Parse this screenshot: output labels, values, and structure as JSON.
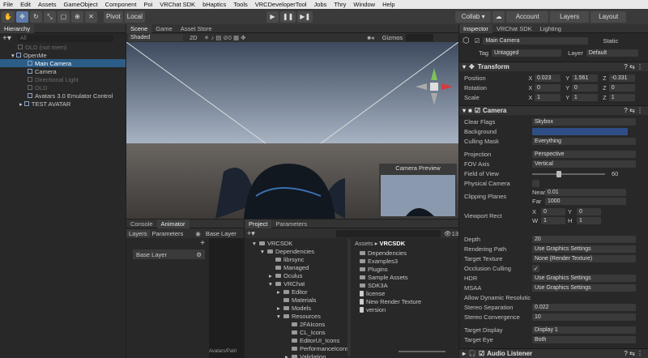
{
  "menu": [
    "File",
    "Edit",
    "Assets",
    "GameObject",
    "Component",
    "Poi",
    "VRChat SDK",
    "bHaptics",
    "Tools",
    "VRCDeveloperTool",
    "Jobs",
    "Thry",
    "Window",
    "Help"
  ],
  "toolbar": {
    "pivot": "Pivot",
    "local": "Local",
    "collab": "Collab ▾",
    "account": "Account",
    "layers": "Layers",
    "layout": "Layout"
  },
  "hierarchy": {
    "tab": "Hierarchy",
    "search": "All",
    "items": [
      "OLD (not mem)",
      "OpenMe",
      "Main Camera",
      "Camera",
      "Directional Light",
      "OLD",
      "Avatars 3.0 Emulator Control",
      "TEST AVATAR"
    ]
  },
  "scene": {
    "tabs": [
      "Scene",
      "Game",
      "Asset Store"
    ],
    "shading": "Shaded",
    "mode2d": "2D",
    "gizmos": "Gizmos",
    "preview_title": "Camera Preview"
  },
  "console": {
    "tabs": [
      "Console",
      "Animator"
    ],
    "sub": [
      "Layers",
      "Parameters"
    ],
    "base": "Base Layer",
    "base_layer": "Base Layer",
    "avatar_path": "Avatars/Patri"
  },
  "project": {
    "tabs": [
      "Project",
      "Parameters"
    ],
    "tree": [
      "VRCSDK",
      "Dependencies",
      "librsync",
      "Managed",
      "Oculus",
      "VRChat",
      "Editor",
      "Materials",
      "Models",
      "Resources",
      "2FAIcons",
      "CL_Icons",
      "EditorUI_Icons",
      "PerformanceIcons",
      "Validation"
    ],
    "breadcrumb": [
      "Assets",
      "VRCSDK"
    ],
    "files": [
      "Dependencies",
      "Examples3",
      "Plugins",
      "Sample Assets",
      "SDK3A",
      "license",
      "New Render Texture",
      "version"
    ],
    "count": "13"
  },
  "inspector": {
    "tabs": [
      "Inspector",
      "VRChat SDK",
      "Lighting"
    ],
    "name": "Main Camera",
    "static": "Static",
    "tag_label": "Tag",
    "tag": "Untagged",
    "layer_label": "Layer",
    "layer": "Default",
    "transform": "Transform",
    "pos": [
      "Position",
      "X",
      "0.023",
      "Y",
      "1.561",
      "Z",
      "-0.331"
    ],
    "rot": [
      "Rotation",
      "X",
      "0",
      "Y",
      "0",
      "Z",
      "0"
    ],
    "scl": [
      "Scale",
      "X",
      "1",
      "Y",
      "1",
      "Z",
      "1"
    ],
    "camera": "Camera",
    "rows": [
      [
        "Clear Flags",
        "Skybox"
      ],
      [
        "Background",
        ""
      ],
      [
        "Culling Mask",
        "Everything"
      ],
      [
        "Projection",
        "Perspective"
      ],
      [
        "FOV Axis",
        "Vertical"
      ],
      [
        "Field of View",
        "60"
      ],
      [
        "Physical Camera",
        ""
      ],
      [
        "Clipping Planes",
        "Near",
        "0.01",
        "Far",
        "1000"
      ],
      [
        "Viewport Rect",
        "X",
        "0",
        "Y",
        "0",
        "W",
        "1",
        "H",
        "1"
      ],
      [
        "Depth",
        "20"
      ],
      [
        "Rendering Path",
        "Use Graphics Settings"
      ],
      [
        "Target Texture",
        "None (Render Texture)"
      ],
      [
        "Occlusion Culling",
        "✓"
      ],
      [
        "HDR",
        "Use Graphics Settings"
      ],
      [
        "MSAA",
        "Use Graphics Settings"
      ],
      [
        "Allow Dynamic Resolutic",
        ""
      ],
      [
        "Stereo Separation",
        "0.022"
      ],
      [
        "Stereo Convergence",
        "10"
      ],
      [
        "Target Display",
        "Display 1"
      ],
      [
        "Target Eye",
        "Both"
      ]
    ],
    "audio": "Audio Listener"
  }
}
